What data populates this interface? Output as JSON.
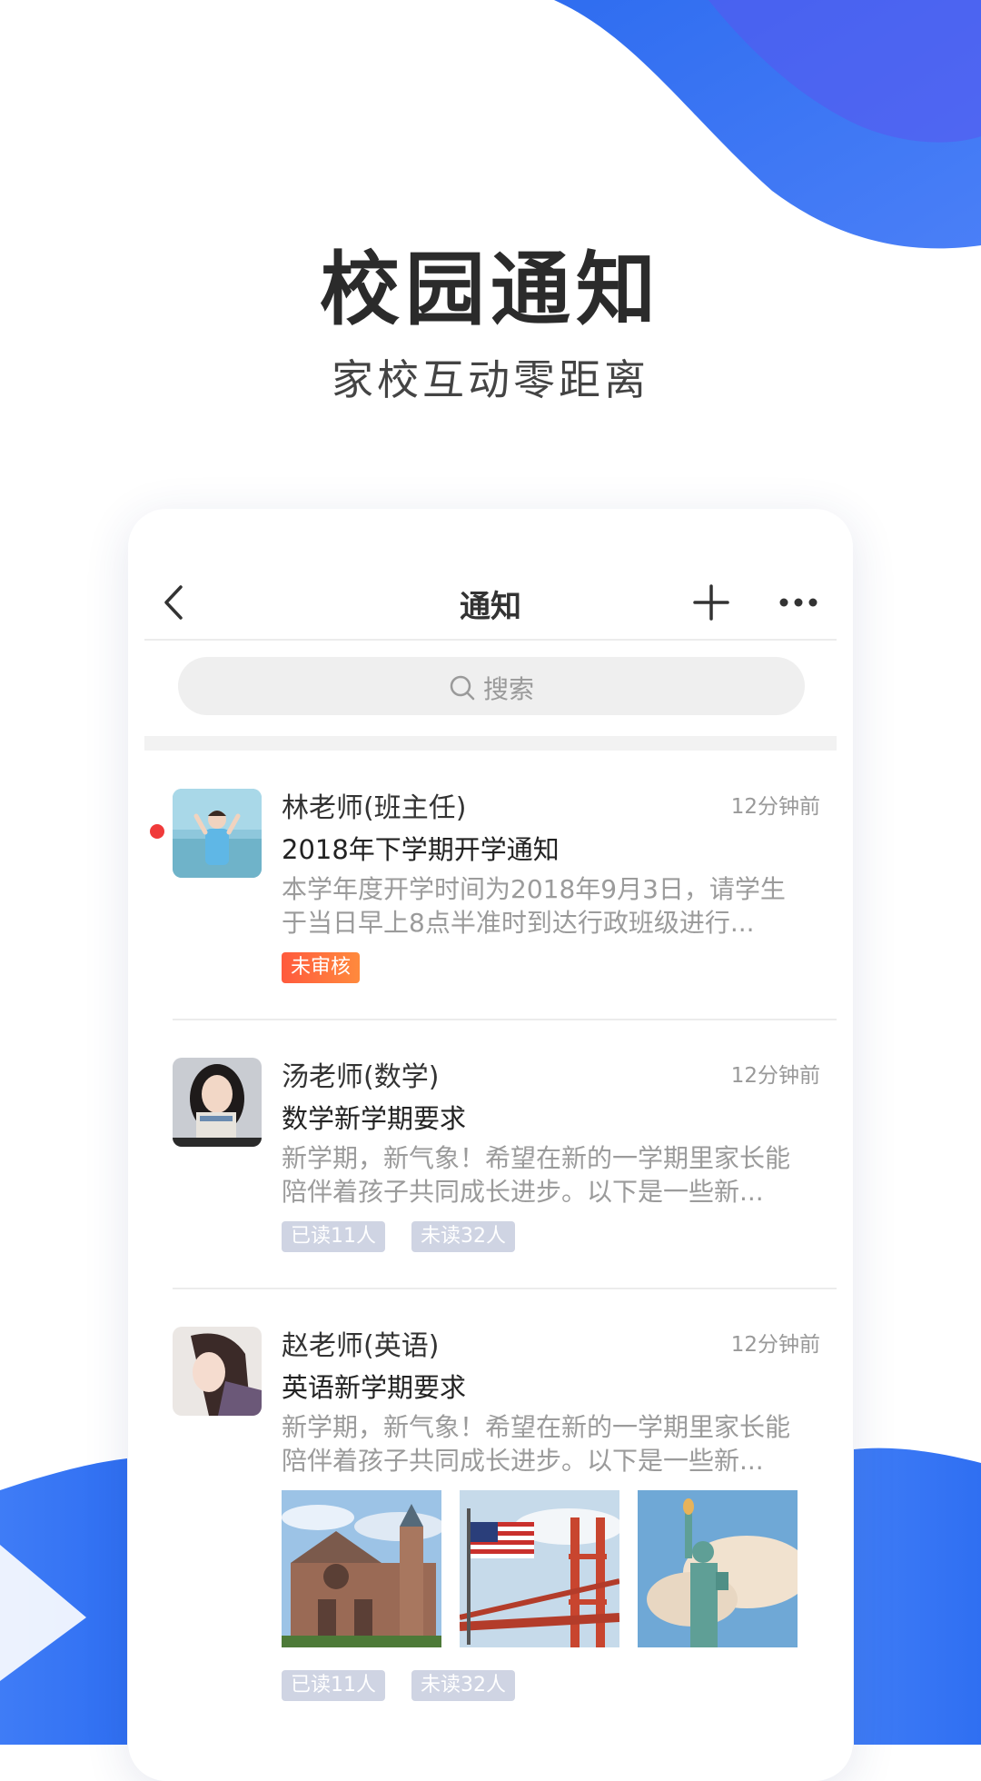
{
  "hero": {
    "title": "校园通知",
    "subtitle": "家校互动零距离"
  },
  "nav": {
    "title": "通知"
  },
  "search": {
    "placeholder": "搜索"
  },
  "notices": [
    {
      "sender": "林老师(班主任)",
      "time": "12分钟前",
      "subject": "2018年下学期开学通知",
      "line1": "本学年度开学时间为2018年9月3日，请学生",
      "line2": "于当日早上8点半准时到达行政班级进行...",
      "unread": true,
      "tags": [
        "未审核"
      ]
    },
    {
      "sender": "汤老师(数学)",
      "time": "12分钟前",
      "subject": "数学新学期要求",
      "line1": "新学期，新气象！希望在新的一学期里家长能",
      "line2": "陪伴着孩子共同成长进步。以下是一些新...",
      "unread": false,
      "tags": [
        "已读11人",
        "未读32人"
      ]
    },
    {
      "sender": "赵老师(英语)",
      "time": "12分钟前",
      "subject": "英语新学期要求",
      "line1": "新学期，新气象！希望在新的一学期里家长能",
      "line2": "陪伴着孩子共同成长进步。以下是一些新...",
      "unread": false,
      "tags": [
        "已读11人",
        "未读32人"
      ],
      "images": [
        "cathedral-photo",
        "golden-gate-flag-photo",
        "statue-of-liberty-photo"
      ]
    }
  ],
  "colors": {
    "accent_blue": "#3d7df5",
    "unread_red": "#f03a3a",
    "tag_orange": "#ff6a3d",
    "tag_gray": "#cfd4e3"
  }
}
